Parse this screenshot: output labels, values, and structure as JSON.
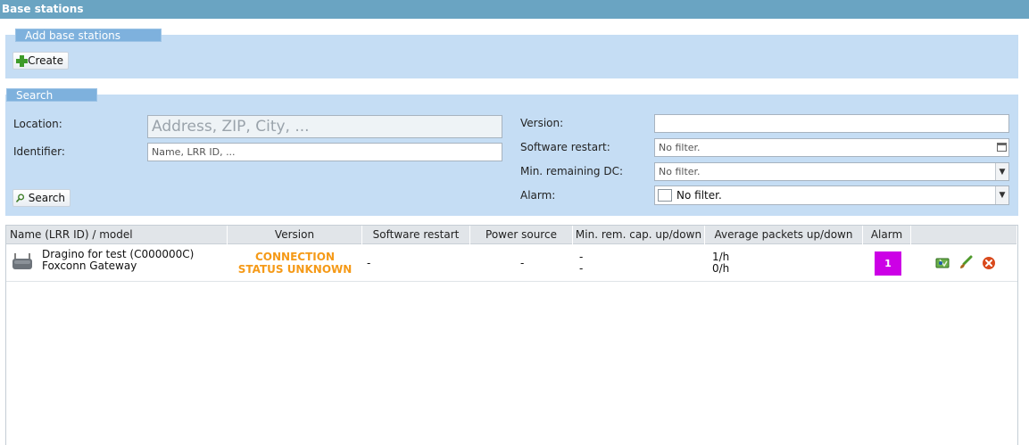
{
  "window": {
    "title": "Base stations"
  },
  "add_panel": {
    "legend": "Add base stations",
    "create_label": "Create"
  },
  "search_panel": {
    "legend": "Search",
    "location_label": "Location:",
    "location_placeholder": "Address, ZIP, City, ...",
    "identifier_label": "Identifier:",
    "identifier_placeholder": "Name, LRR ID, ...",
    "search_label": "Search",
    "version_label": "Version:",
    "version_value": "",
    "software_restart_label": "Software restart:",
    "software_restart_value": "No filter.",
    "min_dc_label": "Min. remaining DC:",
    "min_dc_value": "No filter.",
    "alarm_label": "Alarm:",
    "alarm_value": "No filter."
  },
  "grid": {
    "columns": [
      "Name (LRR ID) / model",
      "Version",
      "Software restart",
      "Power source",
      "Min. rem. cap. up/down",
      "Average packets up/down",
      "Alarm"
    ],
    "rows": [
      {
        "name": "Dragino for test (C000000C)",
        "model": "Foxconn Gateway",
        "version_line1": "CONNECTION",
        "version_line2": "STATUS UNKNOWN",
        "software_restart": "-",
        "power_source": "-",
        "min_cap_up": "-",
        "min_cap_down": "-",
        "packets_up": "1/h",
        "packets_down": "0/h",
        "alarm": "1"
      }
    ]
  },
  "icons": {
    "create": "plus-icon",
    "search": "magnifier-icon",
    "row_actions": [
      "map-icon",
      "edit-icon",
      "delete-icon"
    ]
  },
  "colors": {
    "title_bar": "#6aa4c2",
    "panel": "#c5ddf4",
    "status": "#f59a18",
    "alarm": "#cc00e6"
  }
}
